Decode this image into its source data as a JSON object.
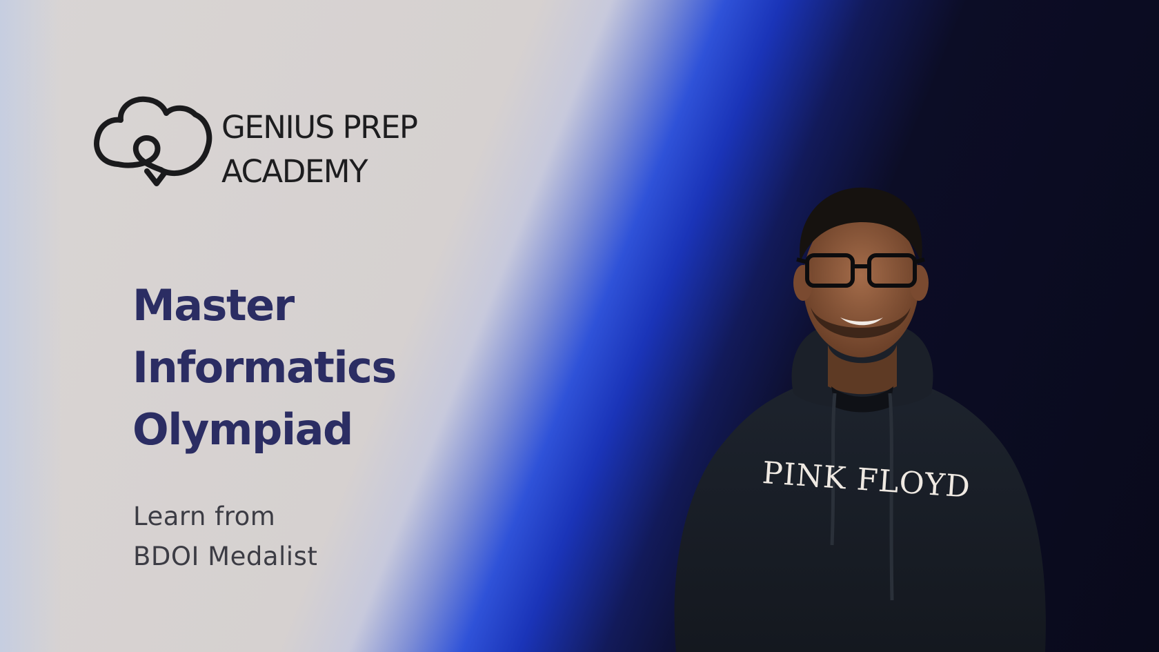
{
  "logo": {
    "line1": "GENIUS PREP",
    "line2": "ACADEMY",
    "icon": "brain-outline-icon"
  },
  "headline": {
    "line1": "Master",
    "line2": "Informatics",
    "line3": "Olympiad"
  },
  "subtitle": {
    "line1": "Learn from",
    "line2": "BDOI Medalist"
  },
  "portrait": {
    "hoodie_text": "PINK FLOYD"
  },
  "colors": {
    "headline": "#2b2d63",
    "accent_blue": "#1f44d0",
    "background_light": "#d7d3d2",
    "background_dark": "#0b0c1e"
  }
}
